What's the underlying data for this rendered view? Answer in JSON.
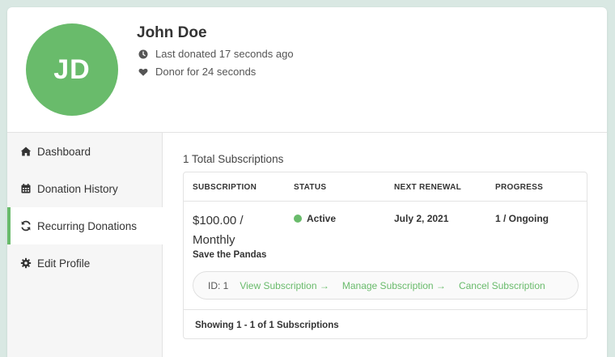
{
  "donor": {
    "initials": "JD",
    "name": "John Doe",
    "last_donated": "Last donated 17 seconds ago",
    "donor_for": "Donor for 24 seconds",
    "avatar_color": "#69bb6b"
  },
  "sidebar": {
    "items": [
      {
        "label": "Dashboard",
        "icon": "home-icon",
        "active": false
      },
      {
        "label": "Donation History",
        "icon": "calendar-icon",
        "active": false
      },
      {
        "label": "Recurring Donations",
        "icon": "sync-icon",
        "active": true
      },
      {
        "label": "Edit Profile",
        "icon": "gear-icon",
        "active": false
      }
    ]
  },
  "main": {
    "total_label": "1 Total Subscriptions",
    "columns": [
      "SUBSCRIPTION",
      "STATUS",
      "NEXT RENEWAL",
      "PROGRESS"
    ],
    "subscription": {
      "amount": "$100.00 / Monthly",
      "campaign": "Save the Pandas",
      "status": "Active",
      "next_renewal": "July 2, 2021",
      "progress": "1 / Ongoing",
      "id_label": "ID: 1",
      "view_label": "View Subscription",
      "manage_label": "Manage Subscription",
      "cancel_label": "Cancel Subscription"
    },
    "footer": "Showing 1 - 1 of 1 Subscriptions"
  },
  "colors": {
    "accent": "#69bb6b",
    "background": "#d9e8e3"
  }
}
